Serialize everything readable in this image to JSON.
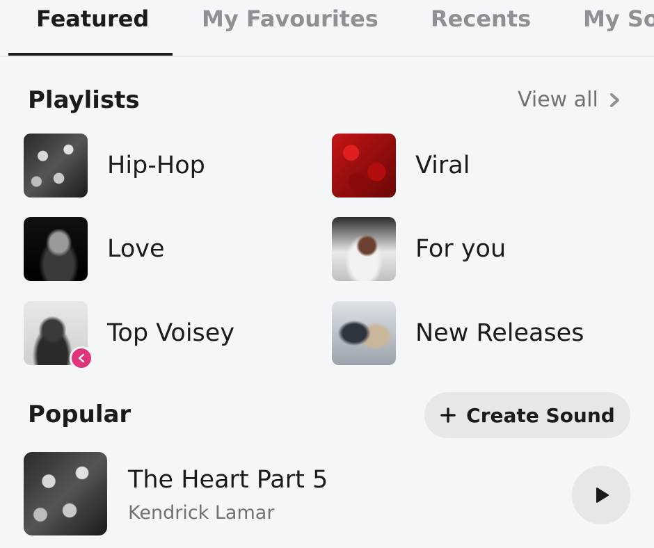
{
  "tabs": [
    {
      "label": "Featured",
      "active": true
    },
    {
      "label": "My Favourites",
      "active": false
    },
    {
      "label": "Recents",
      "active": false
    },
    {
      "label": "My So",
      "active": false
    }
  ],
  "playlists": {
    "title": "Playlists",
    "view_all_label": "View all",
    "items": [
      {
        "label": "Hip-Hop"
      },
      {
        "label": "Viral"
      },
      {
        "label": "Love"
      },
      {
        "label": "For you"
      },
      {
        "label": "Top Voisey"
      },
      {
        "label": "New Releases"
      }
    ]
  },
  "popular": {
    "title": "Popular",
    "create_label": "Create Sound",
    "tracks": [
      {
        "title": "The Heart Part 5",
        "artist": "Kendrick Lamar"
      }
    ]
  },
  "colors": {
    "background": "#f5f6f8",
    "text": "#1b1b1d",
    "muted": "#6e7278",
    "badge": "#e0357c"
  }
}
